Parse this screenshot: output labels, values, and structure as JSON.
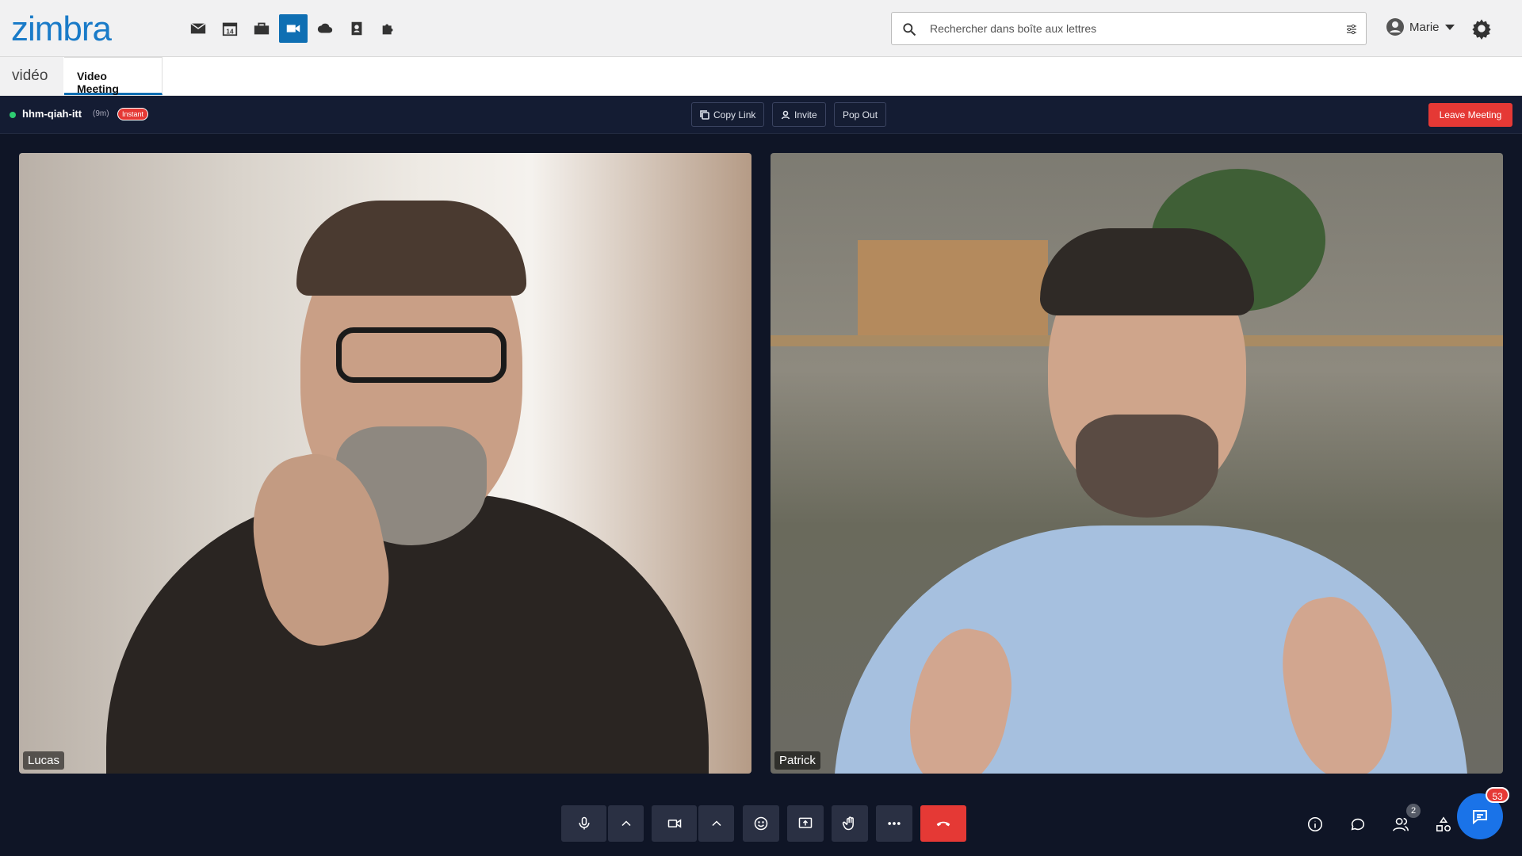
{
  "brand": {
    "logo": "zimbra",
    "accent": "#1a7bc8"
  },
  "apps": [
    {
      "name": "mail-icon"
    },
    {
      "name": "calendar-icon",
      "badge": "14"
    },
    {
      "name": "briefcase-icon"
    },
    {
      "name": "video-icon",
      "active": true
    },
    {
      "name": "cloud-icon"
    },
    {
      "name": "contacts-icon"
    },
    {
      "name": "puzzle-icon"
    }
  ],
  "search": {
    "placeholder": "Rechercher dans boîte aux lettres"
  },
  "user": {
    "name": "Marie"
  },
  "tabs": {
    "app_label": "vidéo",
    "active_tab": "Video Meeting"
  },
  "meeting": {
    "name": "hhm-qiah-itt",
    "duration": "(9m)",
    "badge": "Instant",
    "copy_link": "Copy Link",
    "invite": "Invite",
    "pop_out": "Pop Out",
    "leave": "Leave Meeting",
    "leave_color": "#e53935"
  },
  "participants": [
    {
      "name": "Lucas"
    },
    {
      "name": "Patrick"
    }
  ],
  "controls": {
    "participant_count": "2",
    "chat_unread": "53"
  }
}
